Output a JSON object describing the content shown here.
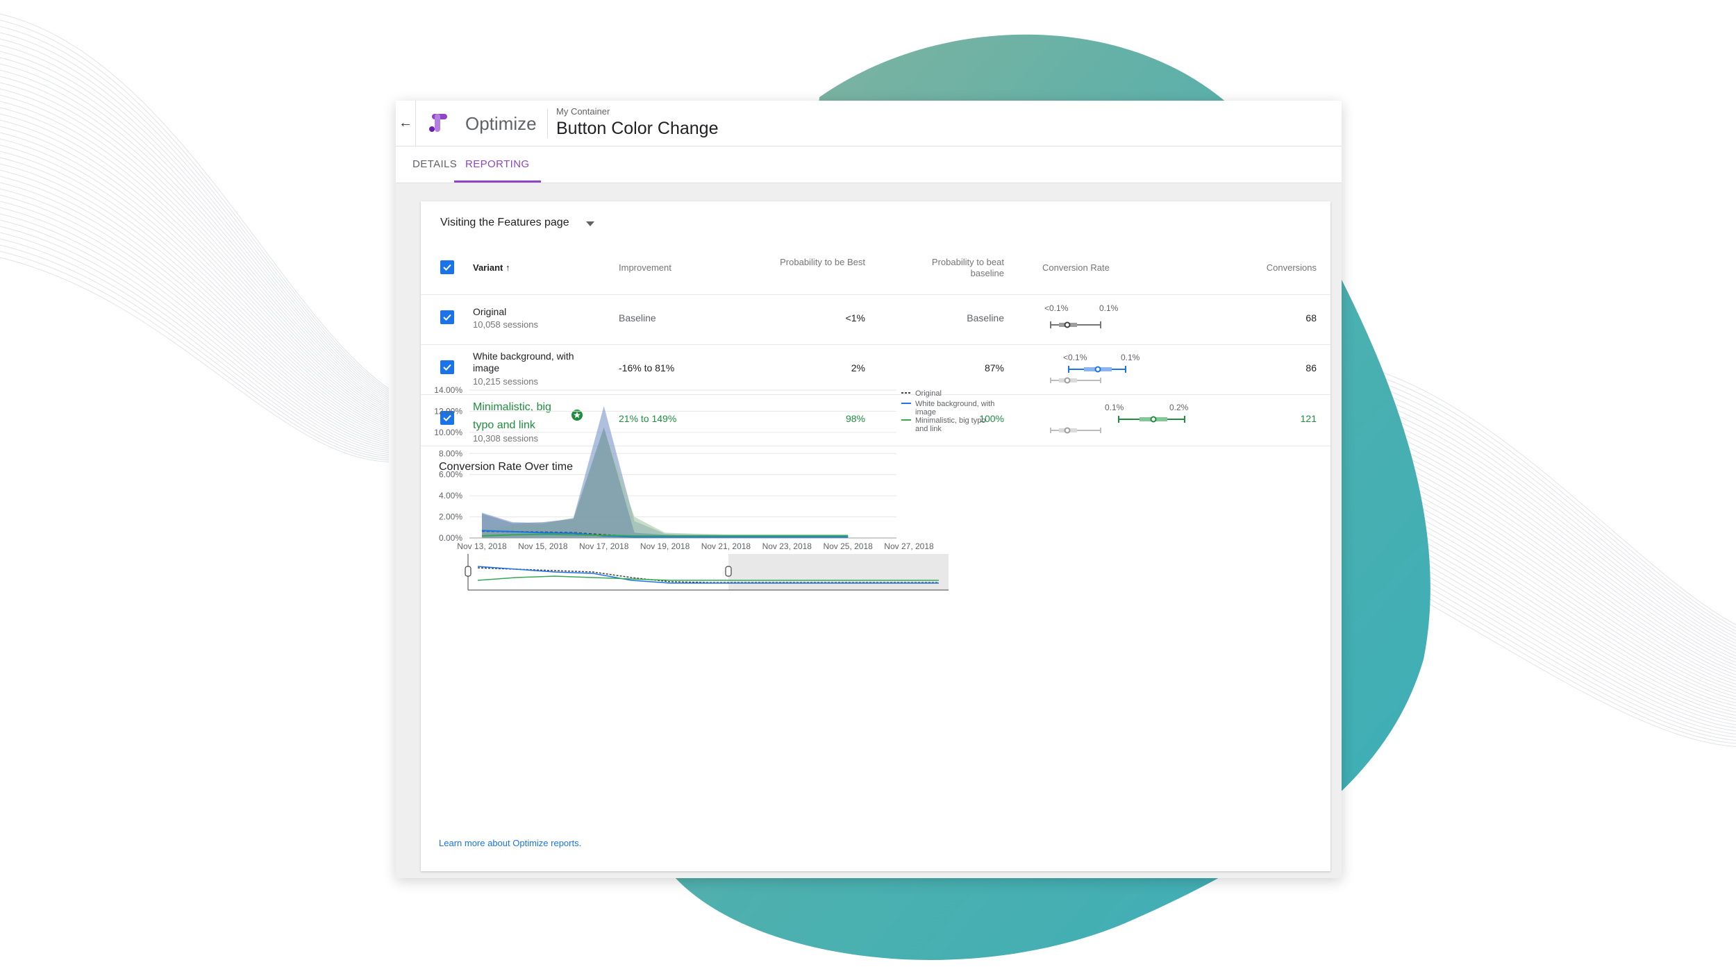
{
  "app": {
    "name": "Optimize",
    "container_label": "My Container",
    "experiment_title": "Button Color Change",
    "back_icon": "arrow-back-icon",
    "brand_color": "#8e44c9"
  },
  "tabs": [
    {
      "label": "DETAILS",
      "active": false
    },
    {
      "label": "REPORTING",
      "active": true
    }
  ],
  "report": {
    "objective": "Visiting the Features page",
    "columns": {
      "variant": "Variant",
      "improvement": "Improvement",
      "prob_best": "Probability to be Best",
      "prob_beat": "Probability to beat baseline",
      "conv_rate": "Conversion Rate",
      "conversions": "Conversions"
    },
    "rows": [
      {
        "name": "Original",
        "sessions": "10,058 sessions",
        "improvement": "Baseline",
        "prob_best": "<1%",
        "prob_beat": "Baseline",
        "ci_low": "<0.1%",
        "ci_high": "0.1%",
        "conversions": "68"
      },
      {
        "name": "White background, with image",
        "sessions": "10,215 sessions",
        "improvement": "-16% to 81%",
        "prob_best": "2%",
        "prob_beat": "87%",
        "ci_low": "<0.1%",
        "ci_high": "0.1%",
        "conversions": "86"
      },
      {
        "name": "Minimalistic, big typo and link",
        "sessions": "10,308 sessions",
        "improvement": "21% to 149%",
        "prob_best": "98%",
        "prob_beat": "100%",
        "ci_low": "0.1%",
        "ci_high": "0.2%",
        "conversions": "121",
        "leader": true
      }
    ],
    "chart_title": "Conversion Rate Over time",
    "learn_more": "Learn more about Optimize reports."
  },
  "colors": {
    "original": "#424242",
    "white_bg": "#1a73e8",
    "minimal": "#34a853",
    "blob": "#3fb0b4"
  },
  "chart_data": {
    "type": "area",
    "x": [
      "Nov 13, 2018",
      "Nov 14, 2018",
      "Nov 15, 2018",
      "Nov 16, 2018",
      "Nov 17, 2018",
      "Nov 18, 2018",
      "Nov 19, 2018",
      "Nov 20, 2018",
      "Nov 21, 2018",
      "Nov 22, 2018",
      "Nov 23, 2018",
      "Nov 24, 2018",
      "Nov 25, 2018"
    ],
    "x_ticks": [
      "Nov 13, 2018",
      "Nov 15, 2018",
      "Nov 17, 2018",
      "Nov 19, 2018",
      "Nov 21, 2018",
      "Nov 23, 2018",
      "Nov 25, 2018",
      "Nov 27, 2018"
    ],
    "y_ticks": [
      "0.00%",
      "2.00%",
      "4.00%",
      "6.00%",
      "8.00%",
      "10.00%",
      "12.00%",
      "14.00%"
    ],
    "ylim": [
      0,
      14
    ],
    "series": [
      {
        "name": "Original",
        "style": "dashed",
        "values": [
          0.65,
          0.6,
          0.55,
          0.5,
          0.3,
          0.15,
          0.12,
          0.12,
          0.12,
          0.12,
          0.12,
          0.12,
          0.12
        ],
        "band": [
          2.4,
          1.5,
          1.4,
          1.9,
          12.5,
          1.6,
          0.4,
          0.35,
          0.3,
          0.3,
          0.3,
          0.3,
          0.3
        ]
      },
      {
        "name": "White background, with image",
        "style": "solid",
        "values": [
          0.7,
          0.6,
          0.5,
          0.45,
          0.2,
          0.1,
          0.1,
          0.1,
          0.1,
          0.1,
          0.1,
          0.1,
          0.1
        ],
        "band": [
          2.3,
          1.4,
          1.5,
          1.8,
          10.5,
          0.5,
          0.3,
          0.2,
          0.2,
          0.2,
          0.2,
          0.2,
          0.2
        ]
      },
      {
        "name": "Minimalistic, big typo and link",
        "style": "solid",
        "values": [
          0.2,
          0.3,
          0.35,
          0.3,
          0.25,
          0.2,
          0.2,
          0.2,
          0.2,
          0.2,
          0.2,
          0.2,
          0.2
        ],
        "band": [
          0.8,
          1.2,
          1.3,
          1.9,
          10.3,
          2.0,
          0.5,
          0.4,
          0.35,
          0.35,
          0.35,
          0.35,
          0.35
        ]
      }
    ],
    "legend": "right"
  }
}
